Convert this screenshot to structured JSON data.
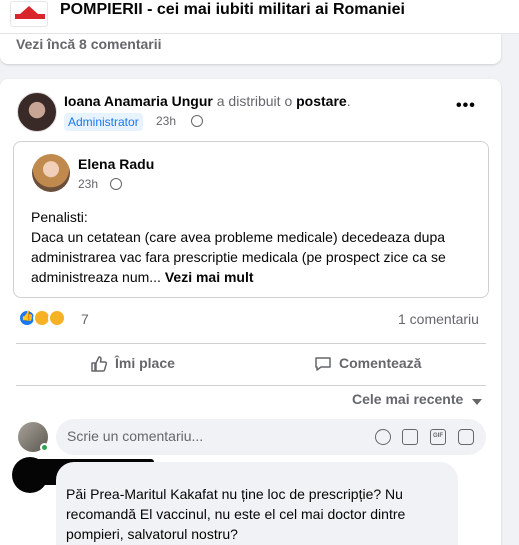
{
  "group": {
    "title": "POMPIERII - cei mai iubiti militari ai Romaniei"
  },
  "previous_post": {
    "see_more_comments": "Vezi încă 8 comentarii"
  },
  "post": {
    "author": "Ioana Anamaria Ungur",
    "action_text": "a distribuit o",
    "post_link": "postare",
    "period": ".",
    "badge": "Administrator",
    "time": "23h",
    "shared": {
      "author": "Elena Radu",
      "time": "23h",
      "text": "Penalisti:\nDaca un cetatean (care avea probleme medicale) decedeaza  dupa administrarea vac fara prescriptie medicala (pe prospect zice ca se administreaza num...",
      "see_more": "Vezi mai mult"
    },
    "reaction_count": "7",
    "comment_count": "1 comentariu",
    "like_label": "Îmi place",
    "comment_label": "Comentează",
    "sort_label": "Cele mai recente",
    "comment_placeholder": "Scrie un comentariu...",
    "gif_label": "GIF"
  },
  "comment": {
    "text": "Păi Prea-Maritul Kakafat nu ține loc de prescripție? Nu recomandă El vaccinul, nu este el cel mai doctor dintre pompieri, salvatorul nostru?"
  },
  "colors": {
    "accent": "#1877f2",
    "secondary_text": "#65676b",
    "online": "#31a24c"
  }
}
